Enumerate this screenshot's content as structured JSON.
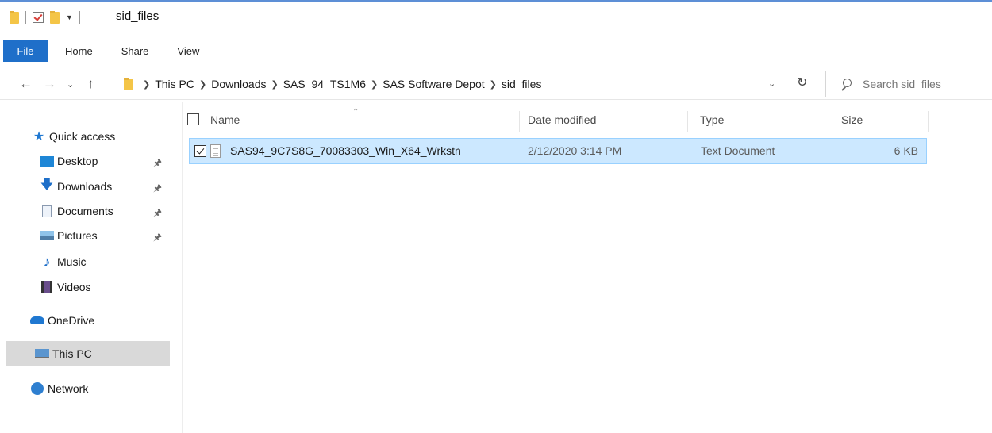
{
  "window": {
    "title": "sid_files",
    "accent_color": "#1f6fc9"
  },
  "ribbon": {
    "tabs": [
      {
        "label": "File"
      },
      {
        "label": "Home"
      },
      {
        "label": "Share"
      },
      {
        "label": "View"
      }
    ]
  },
  "address": {
    "crumbs": [
      "This PC",
      "Downloads",
      "SAS_94_TS1M6",
      "SAS Software Depot",
      "sid_files"
    ]
  },
  "search": {
    "placeholder": "Search sid_files"
  },
  "nav": {
    "quick_access": "Quick access",
    "pinned": [
      {
        "label": "Desktop",
        "icon": "desktop-icon"
      },
      {
        "label": "Downloads",
        "icon": "downloads-icon"
      },
      {
        "label": "Documents",
        "icon": "documents-icon"
      },
      {
        "label": "Pictures",
        "icon": "pictures-icon"
      }
    ],
    "others": [
      {
        "label": "Music",
        "icon": "music-icon"
      },
      {
        "label": "Videos",
        "icon": "videos-icon"
      }
    ],
    "onedrive": "OneDrive",
    "this_pc": "This PC",
    "network": "Network"
  },
  "columns": {
    "name": "Name",
    "date": "Date modified",
    "type": "Type",
    "size": "Size"
  },
  "files": [
    {
      "name": "SAS94_9C7S8G_70083303_Win_X64_Wrkstn",
      "date": "2/12/2020 3:14 PM",
      "type": "Text Document",
      "size": "6 KB",
      "selected": true
    }
  ]
}
